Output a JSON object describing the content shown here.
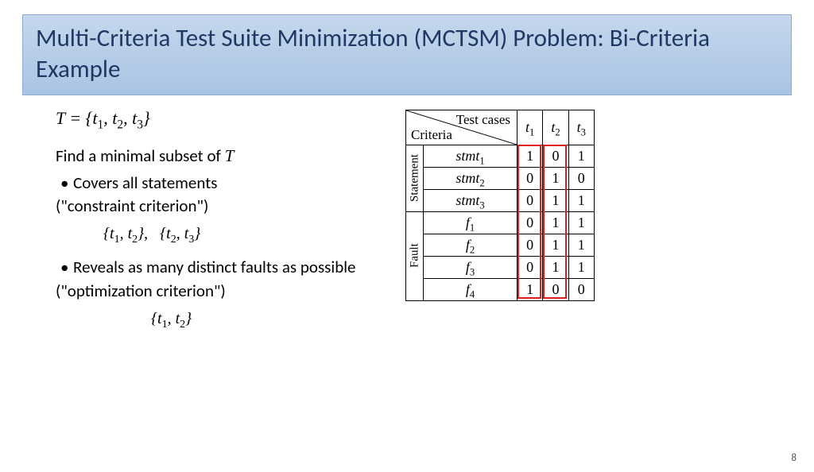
{
  "title": "Multi-Criteria Test Suite Minimization (MCTSM) Problem: Bi-Criteria Example",
  "eq": {
    "lhs": "T",
    "rhs": "{t₁, t₂, t₃}"
  },
  "find_line": "Find a minimal subset of ",
  "find_var": "T",
  "bullet1": "Covers all statements",
  "paren1": "(\"constraint criterion\")",
  "sets1": "{t₁, t₂},   {t₂, t₃}",
  "bullet2": "Reveals as many distinct faults as possible",
  "paren2": "(\"optimization criterion\")",
  "sets2": "{t₁, t₂}",
  "table": {
    "diag_top": "Test cases",
    "diag_left": "Criteria",
    "cols": [
      "t₁",
      "t₂",
      "t₃"
    ],
    "group1": "Statement",
    "group2": "Fault",
    "rows_stmt": [
      {
        "label": "stmt₁",
        "v": [
          "1",
          "0",
          "1"
        ]
      },
      {
        "label": "stmt₂",
        "v": [
          "0",
          "1",
          "0"
        ]
      },
      {
        "label": "stmt₃",
        "v": [
          "0",
          "1",
          "1"
        ]
      }
    ],
    "rows_fault": [
      {
        "label": "f₁",
        "v": [
          "0",
          "1",
          "1"
        ]
      },
      {
        "label": "f₂",
        "v": [
          "0",
          "1",
          "1"
        ]
      },
      {
        "label": "f₃",
        "v": [
          "0",
          "1",
          "1"
        ]
      },
      {
        "label": "f₄",
        "v": [
          "1",
          "0",
          "0"
        ]
      }
    ]
  },
  "highlight_cols": [
    0,
    1
  ],
  "page": "8",
  "chart_data": {
    "type": "table",
    "title": "Test case coverage matrix",
    "columns": [
      "t1",
      "t2",
      "t3"
    ],
    "groups": [
      {
        "name": "Statement",
        "rows": {
          "stmt1": [
            1,
            0,
            1
          ],
          "stmt2": [
            0,
            1,
            0
          ],
          "stmt3": [
            0,
            1,
            1
          ]
        }
      },
      {
        "name": "Fault",
        "rows": {
          "f1": [
            0,
            1,
            1
          ],
          "f2": [
            0,
            1,
            1
          ],
          "f3": [
            0,
            1,
            1
          ],
          "f4": [
            1,
            0,
            0
          ]
        }
      }
    ],
    "highlighted_columns": [
      "t1",
      "t2"
    ]
  }
}
